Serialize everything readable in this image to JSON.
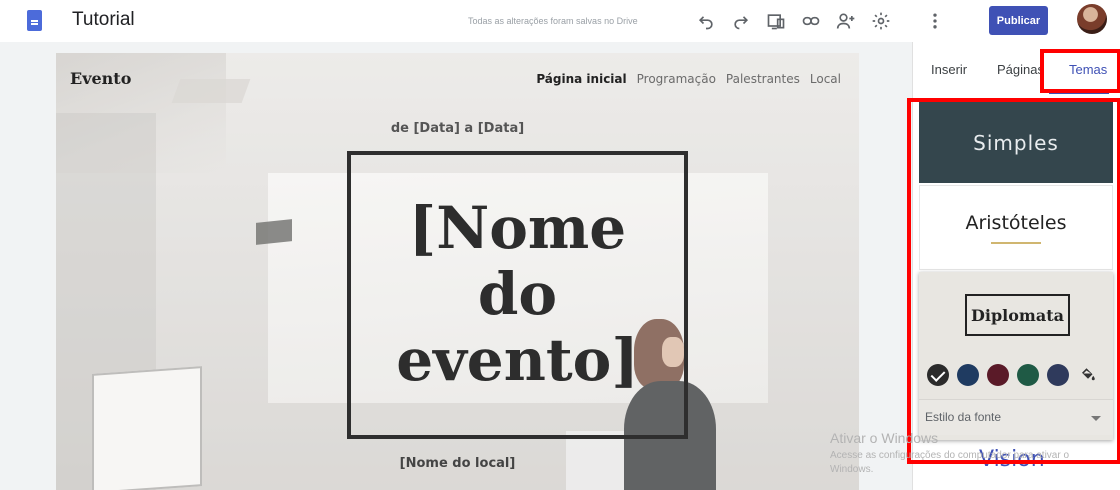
{
  "header": {
    "title": "Tutorial",
    "save_status": "Todas as alterações foram salvas no Drive",
    "publish_label": "Publicar",
    "icons": [
      "sites-doc-icon",
      "undo-icon",
      "redo-icon",
      "preview-icon",
      "insert-link-icon",
      "share-icon",
      "settings-icon",
      "more-vert-icon",
      "account-avatar"
    ]
  },
  "site": {
    "logo": "Evento",
    "nav": [
      "Página inicial",
      "Programação",
      "Palestrantes",
      "Local"
    ],
    "dates": "de [Data] a [Data]",
    "event_title": "[Nome do evento]",
    "event_title_lines": [
      "[Nome",
      "do",
      "evento]"
    ],
    "venue": "[Nome do local]"
  },
  "panel": {
    "tabs": [
      {
        "label": "Inserir",
        "active": false
      },
      {
        "label": "Páginas",
        "active": false
      },
      {
        "label": "Temas",
        "active": true
      }
    ],
    "themes": {
      "simples": "Simples",
      "aristoteles": "Aristóteles",
      "diplomata": "Diplomata"
    },
    "selected_theme": "Diplomata",
    "swatches": [
      {
        "color": "#2b2b2b",
        "selected": true
      },
      {
        "color": "#1f3b61",
        "selected": false
      },
      {
        "color": "#5a1a28",
        "selected": false
      },
      {
        "color": "#1f5a45",
        "selected": false
      },
      {
        "color": "#2f3a5c",
        "selected": false
      }
    ],
    "font_style_label": "Estilo da fonte",
    "next_theme_peek": "Vision"
  },
  "watermark": {
    "title": "Ativar o Windows",
    "subtitle": "Acesse as configurações do computador para ativar o Windows."
  },
  "colors": {
    "accent": "#3f51b5",
    "highlight": "#ff0000",
    "simples_bg": "#34464d"
  }
}
